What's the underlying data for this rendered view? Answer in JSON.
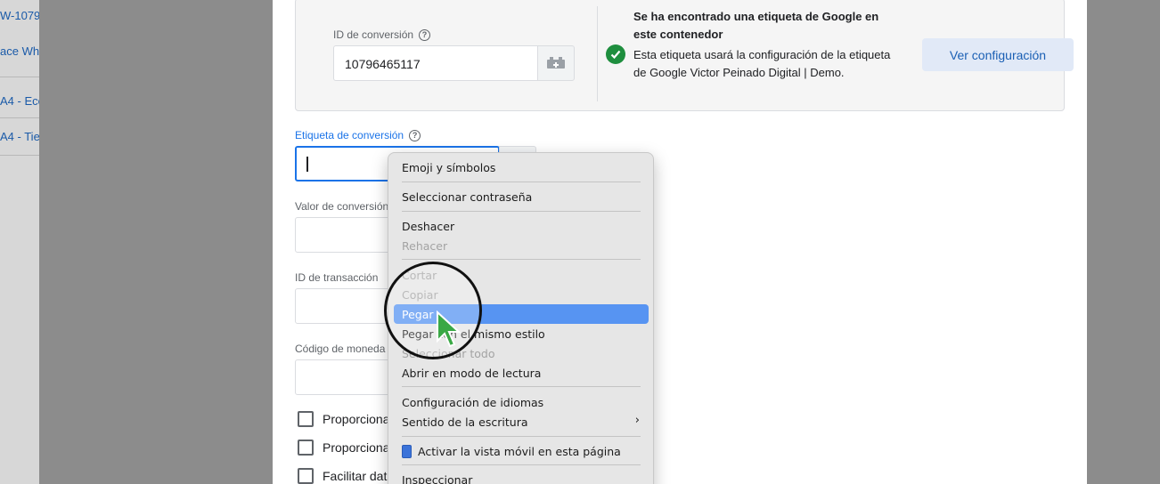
{
  "left_list": {
    "items": [
      {
        "label": "W-1079"
      },
      {
        "label": "ace Wh"
      },
      {
        "label": "A4 - Eco"
      },
      {
        "label": "A4 - Tien"
      }
    ]
  },
  "conversion_id": {
    "label": "ID de conversión",
    "value": "10796465117"
  },
  "google_tag_info": {
    "title": "Se ha encontrado una etiqueta de Google en este contenedor",
    "description": "Esta etiqueta usará la configuración de la etiqueta de Google Victor Peinado Digital | Demo.",
    "button_label": "Ver configuración"
  },
  "fields": {
    "conversion_label": {
      "label": "Etiqueta de conversión",
      "value": ""
    },
    "conversion_value": {
      "label": "Valor de conversión"
    },
    "transaction_id": {
      "label": "ID de transacción"
    },
    "currency_code": {
      "label": "Código de moneda"
    }
  },
  "checkboxes": [
    {
      "label": "Proporciona"
    },
    {
      "label": "Proporciona"
    },
    {
      "label": "Facilitar dat"
    }
  ],
  "context_menu": {
    "items": [
      {
        "label": "Emoji y símbolos",
        "disabled": false
      },
      {
        "label": "Seleccionar contraseña",
        "disabled": false
      },
      {
        "label": "Deshacer",
        "disabled": false
      },
      {
        "label": "Rehacer",
        "disabled": true
      },
      {
        "label": "Cortar",
        "disabled": true
      },
      {
        "label": "Copiar",
        "disabled": true
      },
      {
        "label": "Pegar",
        "disabled": false,
        "highlighted": true
      },
      {
        "label": "Pegar con el mismo estilo",
        "disabled": false
      },
      {
        "label": "Seleccionar todo",
        "disabled": true
      },
      {
        "label": "Abrir en modo de lectura",
        "disabled": false
      },
      {
        "label": "Configuración de idiomas",
        "disabled": false
      },
      {
        "label": "Sentido de la escritura",
        "disabled": false,
        "submenu": true
      },
      {
        "label": "Activar la vista móvil en esta página",
        "disabled": false,
        "icon": "phone-icon"
      },
      {
        "label": "Inspeccionar",
        "disabled": false
      }
    ]
  },
  "colors": {
    "accent": "#1a73e8",
    "menu_highlight": "#5794f2",
    "success": "#1e8e3e"
  }
}
